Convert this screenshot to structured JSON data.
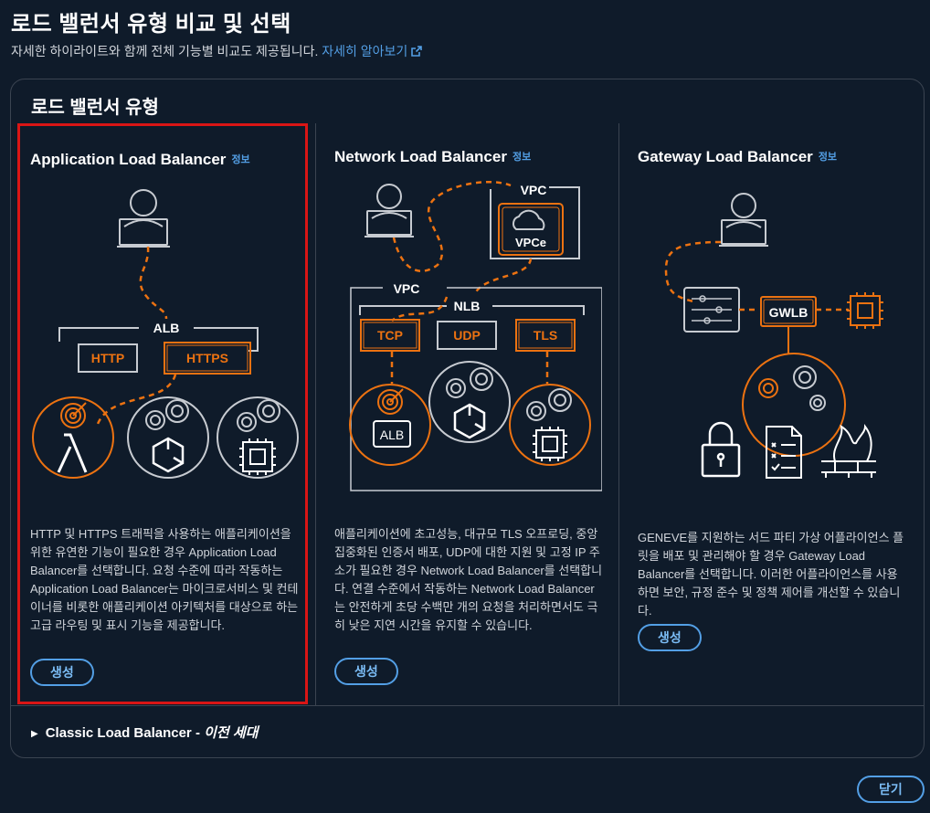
{
  "header": {
    "title": "로드 밸런서 유형 비교 및 선택",
    "subtitle": "자세한 하이라이트와 함께 전체 기능별 비교도 제공됩니다.",
    "learn_more": "자세히 알아보기"
  },
  "panel": {
    "title": "로드 밸런서 유형"
  },
  "cards": [
    {
      "title": "Application Load Balancer",
      "info": "정보",
      "description": "HTTP 및 HTTPS 트래픽을 사용하는 애플리케이션을 위한 유연한 기능이 필요한 경우 Application Load Balancer를 선택합니다. 요청 수준에 따라 작동하는 Application Load Balancer는 마이크로서비스 및 컨테이너를 비롯한 애플리케이션 아키텍처를 대상으로 하는 고급 라우팅 및 표시 기능을 제공합니다.",
      "create": "생성",
      "diagram": {
        "group": "ALB",
        "protocols": [
          "HTTP",
          "HTTPS"
        ]
      }
    },
    {
      "title": "Network Load Balancer",
      "info": "정보",
      "description": "애플리케이션에 초고성능, 대규모 TLS 오프로딩, 중앙 집중화된 인증서 배포, UDP에 대한 지원 및 고정 IP 주소가 필요한 경우 Network Load Balancer를 선택합니다. 연결 수준에서 작동하는 Network Load Balancer는 안전하게 초당 수백만 개의 요청을 처리하면서도 극히 낮은 지연 시간을 유지할 수 있습니다.",
      "create": "생성",
      "diagram": {
        "vpc_top": "VPC",
        "vpce": "VPCe",
        "vpc": "VPC",
        "group": "NLB",
        "protocols": [
          "TCP",
          "UDP",
          "TLS"
        ],
        "target": "ALB"
      }
    },
    {
      "title": "Gateway Load Balancer",
      "info": "정보",
      "description": "GENEVE를 지원하는 서드 파티 가상 어플라이언스 플릿을 배포 및 관리해야 할 경우 Gateway Load Balancer를 선택합니다. 이러한 어플라이언스를 사용하면 보안, 규정 준수 및 정책 제어를 개선할 수 있습니다.",
      "create": "생성",
      "diagram": {
        "group": "GWLB"
      }
    }
  ],
  "classic": {
    "label": "Classic Load Balancer - ",
    "suffix": "이전 세대"
  },
  "footer": {
    "close": "닫기"
  },
  "colors": {
    "accent": "#ec7211",
    "link": "#539fe5",
    "selected_border": "#d91515",
    "background": "#0f1b2a"
  }
}
